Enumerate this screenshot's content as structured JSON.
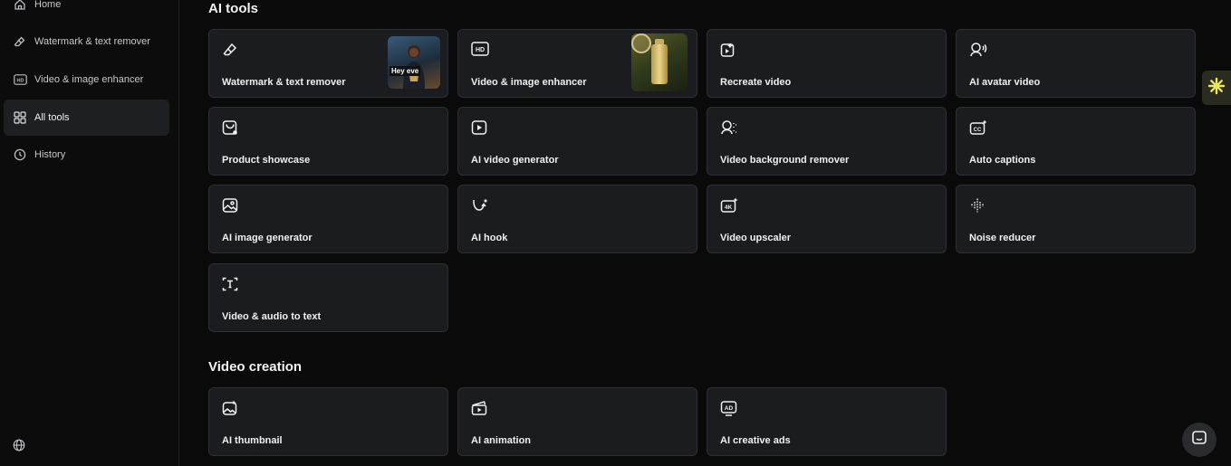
{
  "sidebar": {
    "items": [
      {
        "label": "Home",
        "icon": "home-icon"
      },
      {
        "label": "Watermark & text remover",
        "icon": "eraser-icon"
      },
      {
        "label": "Video & image enhancer",
        "icon": "hd-icon"
      },
      {
        "label": "All tools",
        "icon": "grid-icon",
        "active": true
      },
      {
        "label": "History",
        "icon": "clock-icon"
      }
    ],
    "footer_icon": "globe-icon"
  },
  "sections": {
    "ai_tools": {
      "title": "AI tools",
      "cards": [
        {
          "label": "Watermark & text remover",
          "icon": "eraser-icon",
          "thumb_caption": "Hey eve"
        },
        {
          "label": "Video & image enhancer",
          "icon": "hd-icon"
        },
        {
          "label": "Recreate video",
          "icon": "recreate-icon"
        },
        {
          "label": "AI avatar video",
          "icon": "avatar-voice-icon"
        },
        {
          "label": "Product showcase",
          "icon": "product-bag-icon"
        },
        {
          "label": "AI video generator",
          "icon": "play-icon"
        },
        {
          "label": "Video background remover",
          "icon": "person-cutout-icon"
        },
        {
          "label": "Auto captions",
          "icon": "cc-icon"
        },
        {
          "label": "AI image generator",
          "icon": "image-icon"
        },
        {
          "label": "AI hook",
          "icon": "hook-icon"
        },
        {
          "label": "Video upscaler",
          "icon": "4k-icon"
        },
        {
          "label": "Noise reducer",
          "icon": "waveform-icon"
        },
        {
          "label": "Video & audio to text",
          "icon": "text-frame-icon"
        }
      ]
    },
    "video_creation": {
      "title": "Video creation",
      "cards": [
        {
          "label": "AI thumbnail",
          "icon": "thumbnail-icon"
        },
        {
          "label": "AI animation",
          "icon": "clapper-icon"
        },
        {
          "label": "AI creative ads",
          "icon": "ad-icon"
        }
      ]
    }
  },
  "colors": {
    "accent": "#e8e85a",
    "card_bg": "#1b1c1f",
    "page_bg": "#0a0a0b"
  }
}
